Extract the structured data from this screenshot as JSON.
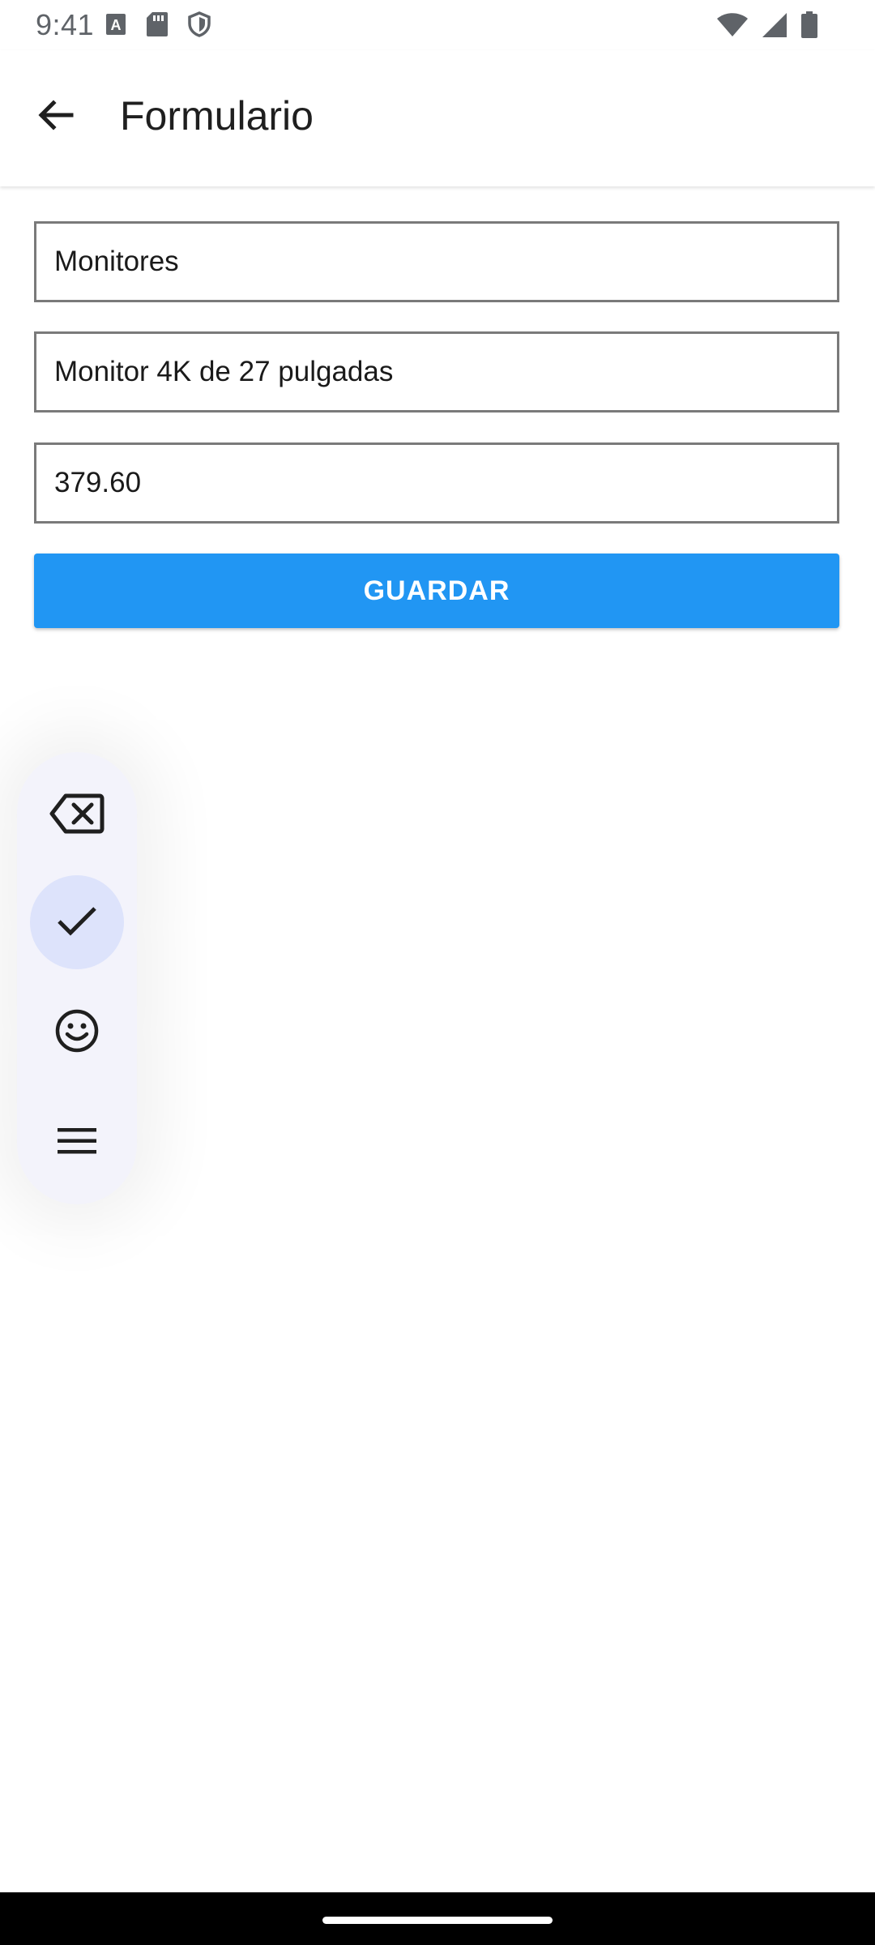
{
  "status_bar": {
    "time": "9:41",
    "left_icons": [
      "text-a-icon",
      "sd-card-icon",
      "shield-icon"
    ],
    "right_icons": [
      "wifi-icon",
      "cellular-signal-icon",
      "battery-icon"
    ]
  },
  "app_bar": {
    "title": "Formulario",
    "back_icon": "arrow-back-icon"
  },
  "form": {
    "fields": [
      {
        "value": "Monitores"
      },
      {
        "value": "Monitor 4K de 27 pulgadas"
      },
      {
        "value": "379.60"
      }
    ],
    "save_label": "GUARDAR"
  },
  "floating_toolbar": {
    "items": [
      {
        "icon": "backspace-icon",
        "active": false
      },
      {
        "icon": "check-icon",
        "active": true
      },
      {
        "icon": "emoji-icon",
        "active": false
      },
      {
        "icon": "menu-icon",
        "active": false
      }
    ]
  },
  "colors": {
    "accent": "#2196f3",
    "toolbar_bg": "#f3f3fb",
    "toolbar_active": "#dde3fb",
    "status_text": "#5f6368"
  }
}
